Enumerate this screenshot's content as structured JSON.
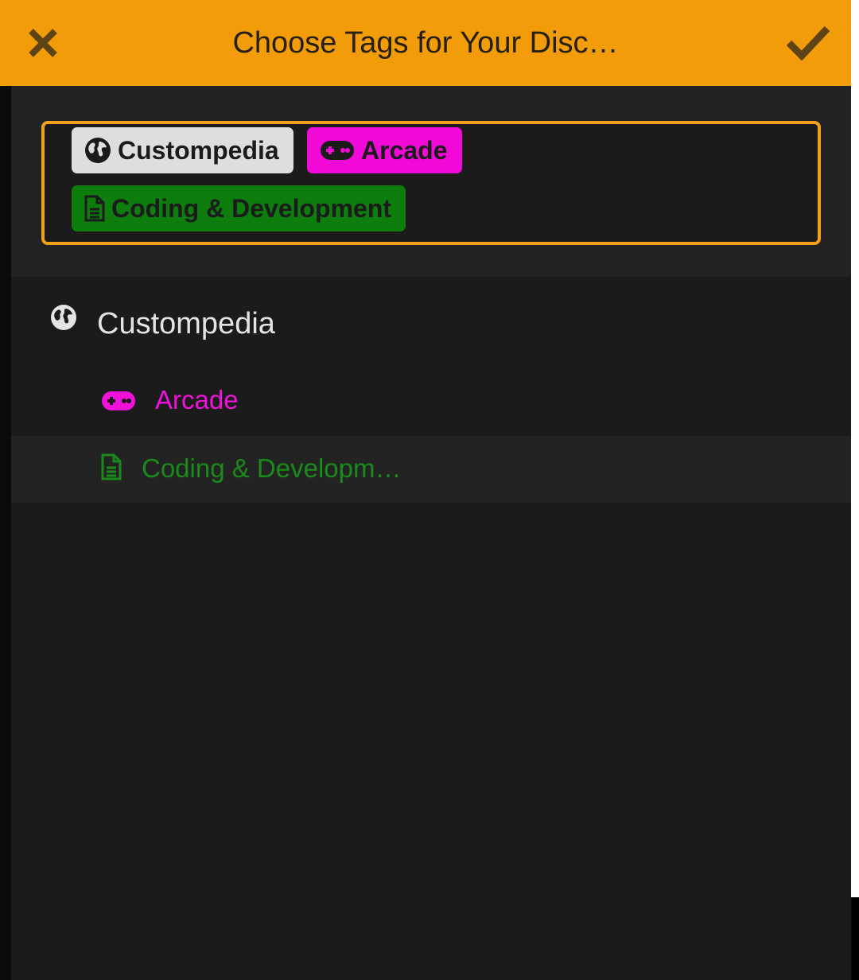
{
  "header": {
    "title": "Choose Tags for Your Disc…",
    "close_icon": "close-icon",
    "confirm_icon": "checkmark-icon"
  },
  "selected_tags": [
    {
      "label": "Custompedia",
      "icon": "globe-icon",
      "color": "#dedede"
    },
    {
      "label": "Arcade",
      "icon": "gamepad-icon",
      "color": "#f209d8"
    },
    {
      "label": "Coding & Development",
      "icon": "document-icon",
      "color": "#0d7e0d"
    }
  ],
  "tag_list": [
    {
      "label": "Custompedia",
      "icon": "globe-icon",
      "color": "#e4e4e4"
    },
    {
      "label": "Arcade",
      "icon": "gamepad-icon",
      "color": "#f012d8"
    },
    {
      "label": "Coding & Developm…",
      "icon": "document-icon",
      "color": "#1a8a1a"
    }
  ],
  "colors": {
    "header_bg": "#f39c0a",
    "accent_border": "#f5a01a",
    "background": "#1b1b1b"
  }
}
